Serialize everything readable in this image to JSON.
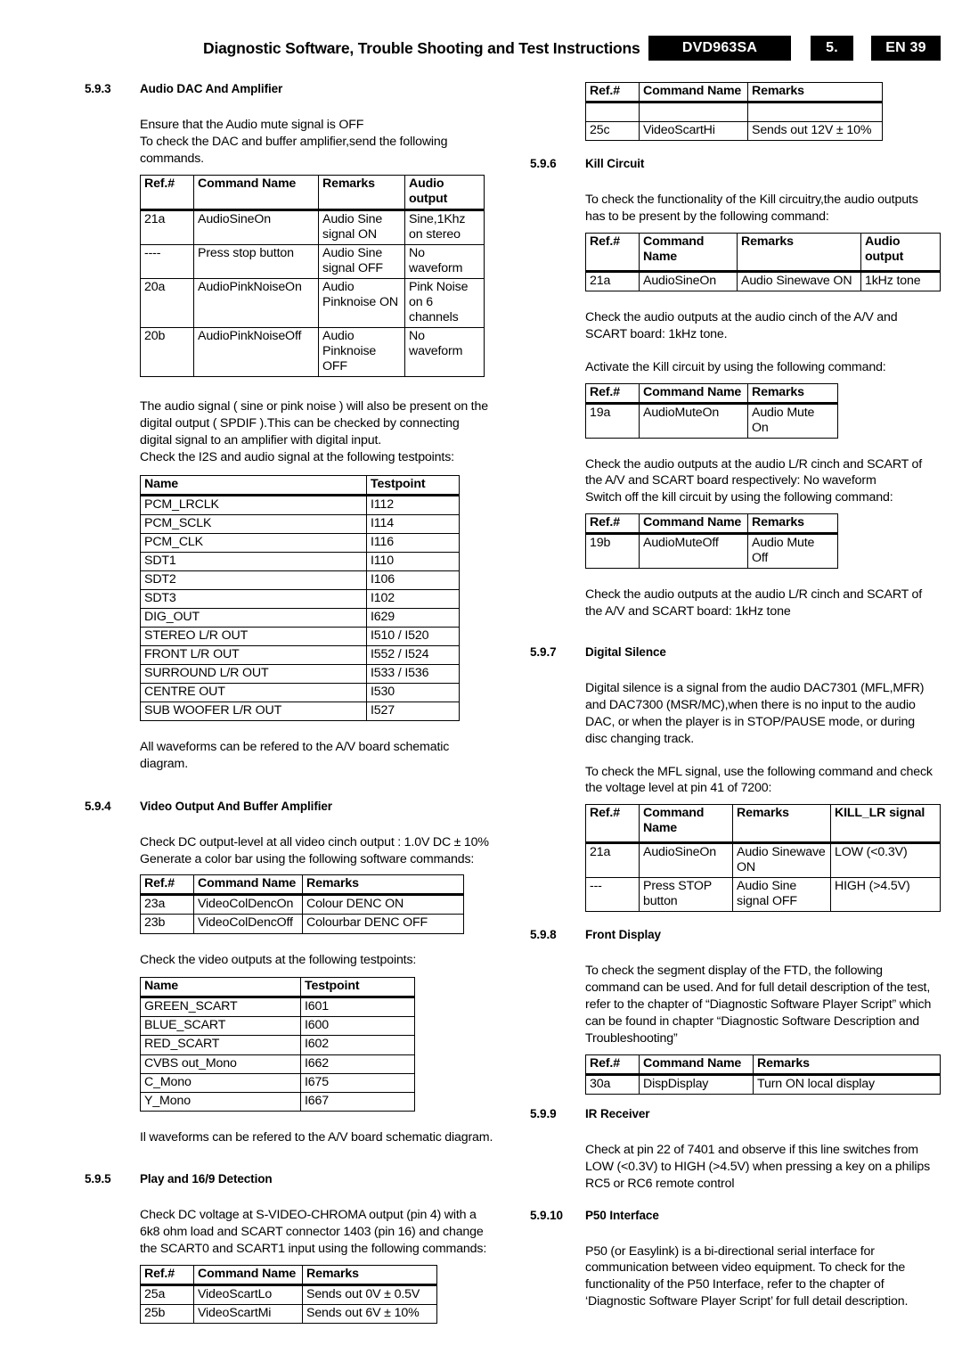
{
  "header": {
    "title": "Diagnostic Software, Trouble Shooting and Test Instructions",
    "model": "DVD963SA",
    "chapter": "5.",
    "page": "EN 39"
  },
  "sections": {
    "s593": {
      "num": "5.9.3",
      "title": "Audio DAC And Amplifier",
      "intro": "Ensure that the Audio mute signal is OFF\nTo check the DAC and buffer amplifier,send the following commands.",
      "table1": {
        "headers": [
          "Ref.#",
          "Command Name",
          "Remarks",
          "Audio output"
        ],
        "rows": [
          [
            "21a",
            "AudioSineOn",
            "Audio Sine signal ON",
            "Sine,1Khz on stereo"
          ],
          [
            "----",
            "Press stop button",
            "Audio Sine signal OFF",
            "No waveform"
          ],
          [
            "20a",
            "AudioPinkNoiseOn",
            "Audio Pinknoise ON",
            "Pink Noise on 6 channels"
          ],
          [
            "20b",
            "AudioPinkNoiseOff",
            "Audio Pinknoise OFF",
            "No waveform"
          ]
        ]
      },
      "para2": "The audio signal ( sine or pink noise ) will also be present on the digital output ( SPDIF ).This can be checked by connecting digital signal to an amplifier with digital input.\nCheck the I2S and audio signal at the following testpoints:",
      "table2": {
        "headers": [
          "Name",
          "Testpoint"
        ],
        "rows": [
          [
            "PCM_LRCLK",
            "I112"
          ],
          [
            "PCM_SCLK",
            "I114"
          ],
          [
            "PCM_CLK",
            "I116"
          ],
          [
            "SDT1",
            "I110"
          ],
          [
            "SDT2",
            "I106"
          ],
          [
            "SDT3",
            "I102"
          ],
          [
            "DIG_OUT",
            "I629"
          ],
          [
            "STEREO L/R OUT",
            "I510 / I520"
          ],
          [
            "FRONT L/R OUT",
            "I552 / I524"
          ],
          [
            "SURROUND L/R OUT",
            "I533 / I536"
          ],
          [
            "CENTRE OUT",
            "I530"
          ],
          [
            "SUB WOOFER L/R OUT",
            "I527"
          ]
        ]
      },
      "outro": "All waveforms can be refered to the A/V board schematic diagram."
    },
    "s594": {
      "num": "5.9.4",
      "title": "Video Output And Buffer Amplifier",
      "intro": "Check DC output-level at all video cinch output : 1.0V DC ± 10%\nGenerate a color bar using the following software commands:",
      "table1": {
        "headers": [
          "Ref.#",
          "Command Name",
          "Remarks"
        ],
        "rows": [
          [
            "23a",
            "VideoColDencOn",
            "Colour DENC ON"
          ],
          [
            "23b",
            "VideoColDencOff",
            "Colourbar DENC OFF"
          ]
        ]
      },
      "para2": "Check the video outputs at the following testpoints:",
      "table2": {
        "headers": [
          "Name",
          "Testpoint"
        ],
        "rows": [
          [
            "GREEN_SCART",
            "I601"
          ],
          [
            "BLUE_SCART",
            "I600"
          ],
          [
            "RED_SCART",
            "I602"
          ],
          [
            "CVBS out_Mono",
            "I662"
          ],
          [
            "C_Mono",
            "I675"
          ],
          [
            "Y_Mono",
            "I667"
          ]
        ]
      },
      "outro": "Il waveforms can be refered to the A/V board schematic diagram."
    },
    "s595": {
      "num": "5.9.5",
      "title": "Play and 16/9 Detection",
      "intro": "Check DC voltage at S-VIDEO-CHROMA output (pin 4) with a 6k8 ohm load and SCART connector 1403 (pin 16) and change the SCART0 and SCART1 input using the following commands:",
      "table1": {
        "headers": [
          "Ref.#",
          "Command Name",
          "Remarks"
        ],
        "rows": [
          [
            "25a",
            "VideoScartLo",
            "Sends out 0V ± 0.5V"
          ],
          [
            "25b",
            "VideoScartMi",
            "Sends out 6V ± 10%"
          ]
        ]
      }
    },
    "s595cont": {
      "table": {
        "headers": [
          "Ref.#",
          "Command Name",
          "Remarks"
        ],
        "rows": [
          [
            "",
            "",
            ""
          ],
          [
            "25c",
            "VideoScartHi",
            "Sends out 12V ± 10%"
          ]
        ]
      }
    },
    "s596": {
      "num": "5.9.6",
      "title": "Kill Circuit",
      "intro": "To check the functionality of the Kill circuitry,the audio outputs has to be present by the following command:",
      "table1": {
        "headers": [
          "Ref.#",
          "Command Name",
          "Remarks",
          "Audio output"
        ],
        "rows": [
          [
            "21a",
            "AudioSineOn",
            "Audio Sinewave ON",
            "1kHz tone"
          ]
        ]
      },
      "para2": "Check the audio outputs at the audio cinch of the A/V and SCART board: 1kHz tone.",
      "para3": "Activate the Kill circuit by using the following command:",
      "table2": {
        "headers": [
          "Ref.#",
          "Command Name",
          "Remarks"
        ],
        "rows": [
          [
            "19a",
            "AudioMuteOn",
            "Audio Mute On"
          ]
        ]
      },
      "para4": "Check the audio outputs at the audio L/R cinch and SCART of the A/V and SCART board respectively: No waveform\nSwitch off the kill circuit by using the following command:",
      "table3": {
        "headers": [
          "Ref.#",
          "Command Name",
          "Remarks"
        ],
        "rows": [
          [
            "19b",
            "AudioMuteOff",
            "Audio Mute Off"
          ]
        ]
      },
      "para5": "Check the audio outputs at the audio L/R cinch and SCART of the A/V and SCART board: 1kHz tone"
    },
    "s597": {
      "num": "5.9.7",
      "title": "Digital Silence",
      "intro": "Digital silence is a signal from the audio DAC7301 (MFL,MFR) and DAC7300 (MSR/MC),when there is no input to the audio DAC, or when the player is in STOP/PAUSE mode, or during disc changing track.",
      "para2": "To check the MFL signal, use the following command and check the voltage level at pin 41 of 7200:",
      "table1": {
        "headers": [
          "Ref.#",
          "Command Name",
          "Remarks",
          "KILL_LR signal"
        ],
        "rows": [
          [
            "21a",
            "AudioSineOn",
            "Audio Sinewave ON",
            "LOW (<0.3V)"
          ],
          [
            "---",
            "Press STOP button",
            "Audio Sine signal OFF",
            "HIGH (>4.5V)"
          ]
        ]
      }
    },
    "s598": {
      "num": "5.9.8",
      "title": "Front Display",
      "intro": "To check the segment display of the FTD, the following command can be used. And for full detail description of the test, refer to the chapter of “Diagnostic Software Player Script” which can be found in chapter “Diagnostic Software Description and Troubleshooting”",
      "table1": {
        "headers": [
          "Ref.#",
          "Command Name",
          "Remarks"
        ],
        "rows": [
          [
            "30a",
            "DispDisplay",
            "Turn ON local display"
          ]
        ]
      }
    },
    "s599": {
      "num": "5.9.9",
      "title": "IR Receiver",
      "intro": "Check at pin 22 of 7401 and observe if this line switches from LOW (<0.3V) to HIGH (>4.5V) when pressing a key on a philips RC5 or RC6 remote control"
    },
    "s5910": {
      "num": "5.9.10",
      "title": "P50 Interface",
      "intro": "P50 (or Easylink) is a bi-directional serial interface for communication between video equipment. To check for the functionality of the P50 Interface, refer to the chapter of ‘Diagnostic Software Player Script’ for full detail description."
    }
  }
}
